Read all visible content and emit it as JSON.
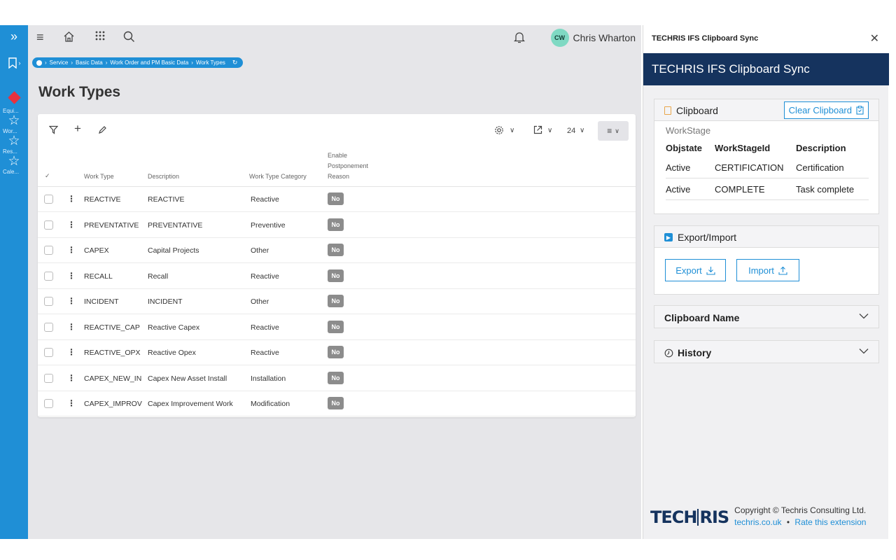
{
  "rail": {
    "favorites": [
      {
        "label": "Equi..."
      },
      {
        "label": "Wor..."
      },
      {
        "label": "Res..."
      },
      {
        "label": "Cale..."
      }
    ]
  },
  "topbar": {
    "user_initials": "CW",
    "user_name": "Chris Wharton"
  },
  "breadcrumb": {
    "items": [
      "Service",
      "Basic Data",
      "Work Order and PM Basic Data",
      "Work Types"
    ]
  },
  "page": {
    "title": "Work Types"
  },
  "toolbar": {
    "page_size": "24"
  },
  "table": {
    "headers": {
      "work_type": "Work Type",
      "description": "Description",
      "category": "Work Type Category",
      "enable_postponement_1": "Enable",
      "enable_postponement_2": "Postponement",
      "enable_postponement_3": "Reason"
    },
    "rows": [
      {
        "work_type": "REACTIVE",
        "description": "REACTIVE",
        "category": "Reactive",
        "postpone": "No"
      },
      {
        "work_type": "PREVENTATIVE",
        "description": "PREVENTATIVE",
        "category": "Preventive",
        "postpone": "No"
      },
      {
        "work_type": "CAPEX",
        "description": "Capital Projects",
        "category": "Other",
        "postpone": "No"
      },
      {
        "work_type": "RECALL",
        "description": "Recall",
        "category": "Reactive",
        "postpone": "No"
      },
      {
        "work_type": "INCIDENT",
        "description": "INCIDENT",
        "category": "Other",
        "postpone": "No"
      },
      {
        "work_type": "REACTIVE_CAP",
        "description": "Reactive Capex",
        "category": "Reactive",
        "postpone": "No"
      },
      {
        "work_type": "REACTIVE_OPX",
        "description": "Reactive Opex",
        "category": "Reactive",
        "postpone": "No"
      },
      {
        "work_type": "CAPEX_NEW_IN",
        "description": "Capex New Asset Install",
        "category": "Installation",
        "postpone": "No"
      },
      {
        "work_type": "CAPEX_IMPROV",
        "description": "Capex Improvement Work",
        "category": "Modification",
        "postpone": "No"
      }
    ]
  },
  "extension": {
    "window_title": "TECHRIS IFS Clipboard Sync",
    "banner": "TECHRIS IFS Clipboard Sync",
    "clipboard": {
      "heading": "Clipboard",
      "clear_label": "Clear Clipboard",
      "entity": "WorkStage",
      "columns": [
        "Objstate",
        "WorkStageId",
        "Description"
      ],
      "rows": [
        [
          "Active",
          "CERTIFICATION",
          "Certification"
        ],
        [
          "Active",
          "COMPLETE",
          "Task complete"
        ]
      ]
    },
    "export_import": {
      "heading": "Export/Import",
      "export_label": "Export",
      "import_label": "Import"
    },
    "clipboard_name": {
      "heading": "Clipboard Name"
    },
    "history": {
      "heading": "History"
    },
    "footer": {
      "logo_left": "TECH",
      "logo_right": "RIS",
      "copyright": "Copyright © Techris Consulting Ltd.",
      "site": "techris.co.uk",
      "separator": "•",
      "rate": "Rate this extension"
    }
  },
  "colors": {
    "rail": "#1f8fd6",
    "banner": "#15335e",
    "badge": "#8c8c8c",
    "avatar": "#7fd9c3"
  }
}
